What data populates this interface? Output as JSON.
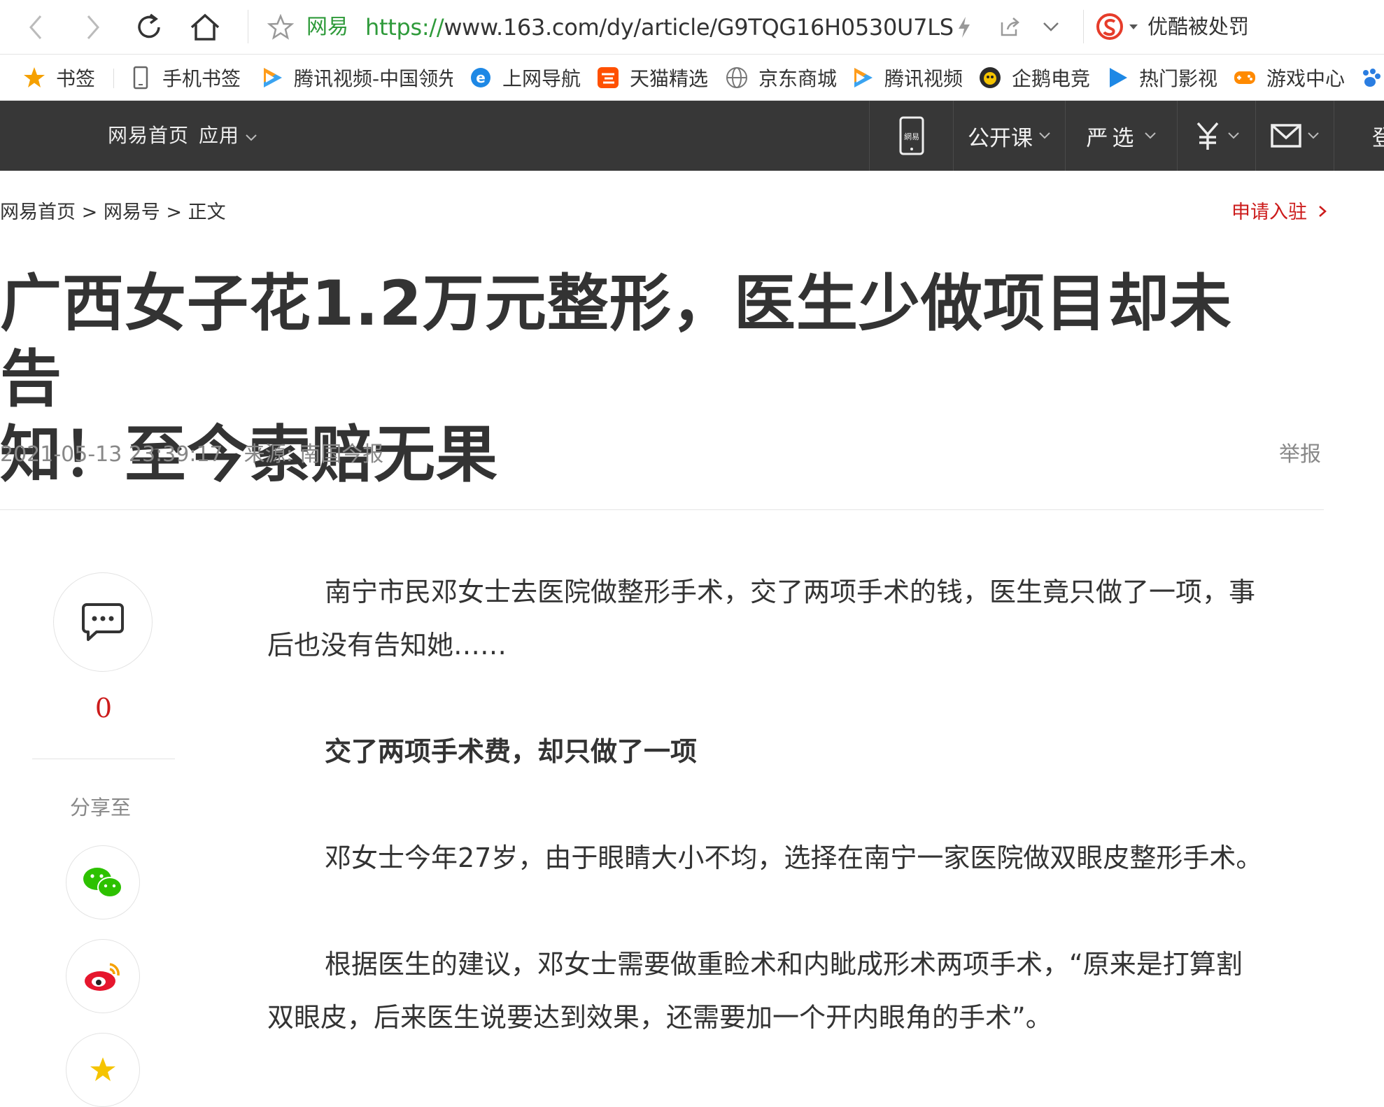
{
  "browser": {
    "site_name": "网易",
    "url_scheme": "https://",
    "url_rest": "www.163.com/dy/article/G9TQG16H0530U7LS",
    "search_query": "优酷被处罚"
  },
  "bookmarks": [
    {
      "label": "书签",
      "icon": "star-icon"
    },
    {
      "label": "手机书签",
      "icon": "phone-icon"
    },
    {
      "label": "腾讯视频-中国领先",
      "icon": "tencent-video-icon"
    },
    {
      "label": "上网导航",
      "icon": "ie-icon"
    },
    {
      "label": "天猫精选",
      "icon": "taobao-icon"
    },
    {
      "label": "京东商城",
      "icon": "globe-icon"
    },
    {
      "label": "腾讯视频",
      "icon": "tencent-video-icon"
    },
    {
      "label": "企鹅电竞",
      "icon": "penguin-icon"
    },
    {
      "label": "热门影视",
      "icon": "play-icon"
    },
    {
      "label": "游戏中心",
      "icon": "gamepad-icon"
    }
  ],
  "site_nav": {
    "home": "网易首页",
    "apps": "应用",
    "open_course": "公开课",
    "yanxuan": "严选",
    "login_partial": "登"
  },
  "breadcrumb": {
    "home": "网易首页",
    "dy": "网易号",
    "current": "正文",
    "separator": ">"
  },
  "apply_link": "申请入驻",
  "article": {
    "title_line1": "广西女子花1.2万元整形，医生少做项目却未告",
    "title_line2": "知！至今索赔无果",
    "date": "2021-05-13 23:39:17",
    "source": "来源: 南国今报",
    "report": "举报",
    "p1_line1": "南宁市民邓女士去医院做整形手术，交了两项手术的钱，医生竟只做了一项，事",
    "p1_line2": "后也没有告知她……",
    "subheading": "交了两项手术费，却只做了一项",
    "p2": "邓女士今年27岁，由于眼睛大小不均，选择在南宁一家医院做双眼皮整形手术。",
    "p3_line1": "根据医生的建议，邓女士需要做重睑术和内眦成形术两项手术，“原来是打算割",
    "p3_line2": "双眼皮，后来医生说要达到效果，还需要加一个开内眼角的手术”。"
  },
  "sidebar": {
    "comment_count": "0",
    "share_label": "分享至"
  },
  "colors": {
    "nav_bg": "#373737",
    "accent_red": "#cc1b1b",
    "url_green": "#2e9a3a"
  }
}
